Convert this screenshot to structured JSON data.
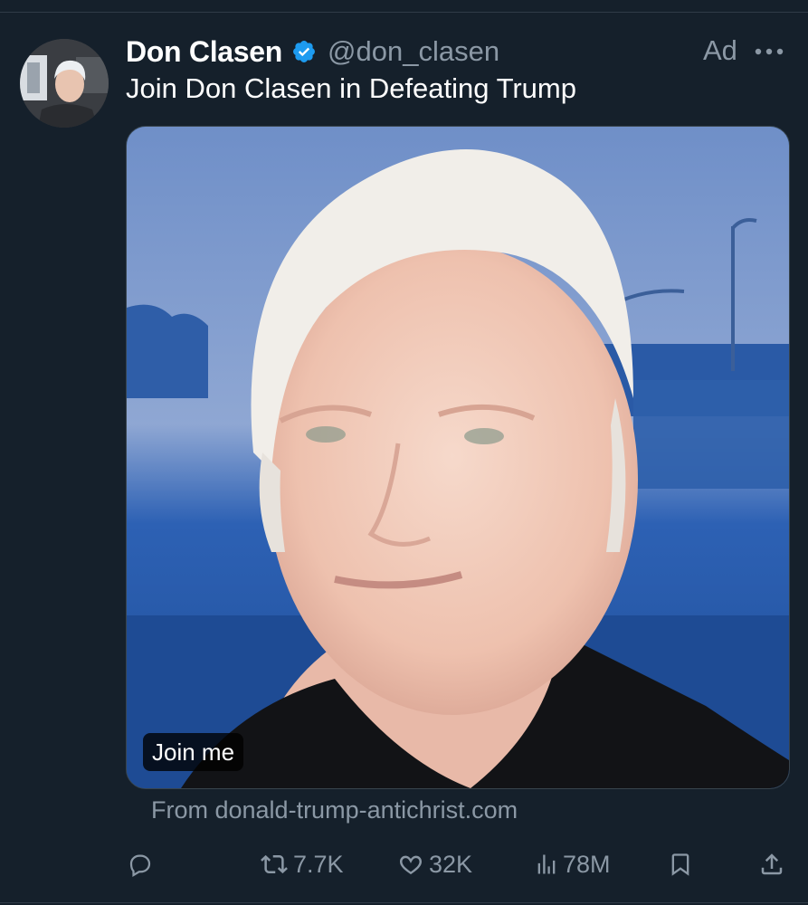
{
  "post": {
    "author_name": "Don Clasen",
    "handle": "@don_clasen",
    "ad_label": "Ad",
    "text": "Join Don Clasen in Defeating Trump",
    "card_label": "Join me",
    "source": "From donald-trump-antichrist.com"
  },
  "actions": {
    "reply_count": "",
    "retweets": "7.7K",
    "likes": "32K",
    "views": "78M"
  },
  "icons": {
    "verified": "verified-badge-icon",
    "more": "more-dots-icon",
    "reply": "reply-icon",
    "retweet": "retweet-icon",
    "like": "heart-icon",
    "views": "views-icon",
    "bookmark": "bookmark-icon",
    "share": "share-icon"
  },
  "colors": {
    "background": "#15202b",
    "secondary_text": "#8b98a5",
    "verified_blue": "#1d9bf0",
    "card_blue": "#2b5da8"
  }
}
